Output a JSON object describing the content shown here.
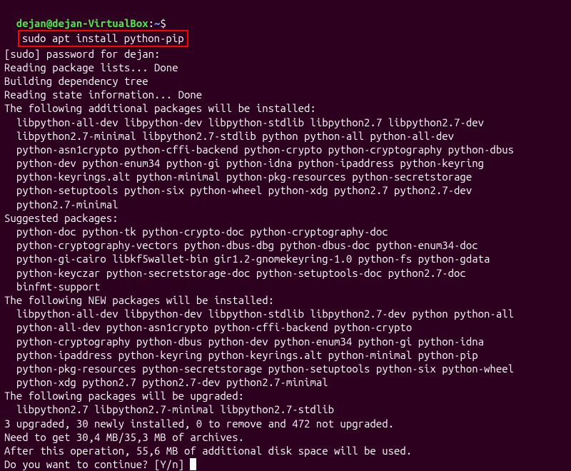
{
  "prompt": {
    "user": "dejan@dejan-VirtualBox",
    "separator": ":",
    "path": "~",
    "dollar": "$",
    "command": "sudo apt install python-pip"
  },
  "output": {
    "l01": "[sudo] password for dejan:",
    "l02": "Reading package lists... Done",
    "l03": "Building dependency tree",
    "l04": "Reading state information... Done",
    "l05": "The following additional packages will be installed:",
    "l06": "  libpython-all-dev libpython-dev libpython-stdlib libpython2.7 libpython2.7-dev",
    "l07": "  libpython2.7-minimal libpython2.7-stdlib python python-all python-all-dev",
    "l08": "  python-asn1crypto python-cffi-backend python-crypto python-cryptography python-dbus",
    "l09": "  python-dev python-enum34 python-gi python-idna python-ipaddress python-keyring",
    "l10": "  python-keyrings.alt python-minimal python-pkg-resources python-secretstorage",
    "l11": "  python-setuptools python-six python-wheel python-xdg python2.7 python2.7-dev",
    "l12": "  python2.7-minimal",
    "l13": "Suggested packages:",
    "l14": "  python-doc python-tk python-crypto-doc python-cryptography-doc",
    "l15": "  python-cryptography-vectors python-dbus-dbg python-dbus-doc python-enum34-doc",
    "l16": "  python-gi-cairo libkf5wallet-bin gir1.2-gnomekeyring-1.0 python-fs python-gdata",
    "l17": "  python-keyczar python-secretstorage-doc python-setuptools-doc python2.7-doc",
    "l18": "  binfmt-support",
    "l19": "The following NEW packages will be installed:",
    "l20": "  libpython-all-dev libpython-dev libpython-stdlib libpython2.7-dev python python-all",
    "l21": "  python-all-dev python-asn1crypto python-cffi-backend python-crypto",
    "l22": "  python-cryptography python-dbus python-dev python-enum34 python-gi python-idna",
    "l23": "  python-ipaddress python-keyring python-keyrings.alt python-minimal python-pip",
    "l24": "  python-pkg-resources python-secretstorage python-setuptools python-six python-wheel",
    "l25": "  python-xdg python2.7 python2.7-dev python2.7-minimal",
    "l26": "The following packages will be upgraded:",
    "l27": "  libpython2.7 libpython2.7-minimal libpython2.7-stdlib",
    "l28": "3 upgraded, 30 newly installed, 0 to remove and 472 not upgraded.",
    "l29": "Need to get 30,4 MB/35,3 MB of archives.",
    "l30": "After this operation, 55,6 MB of additional disk space will be used.",
    "l31": "Do you want to continue? [Y/n] "
  }
}
